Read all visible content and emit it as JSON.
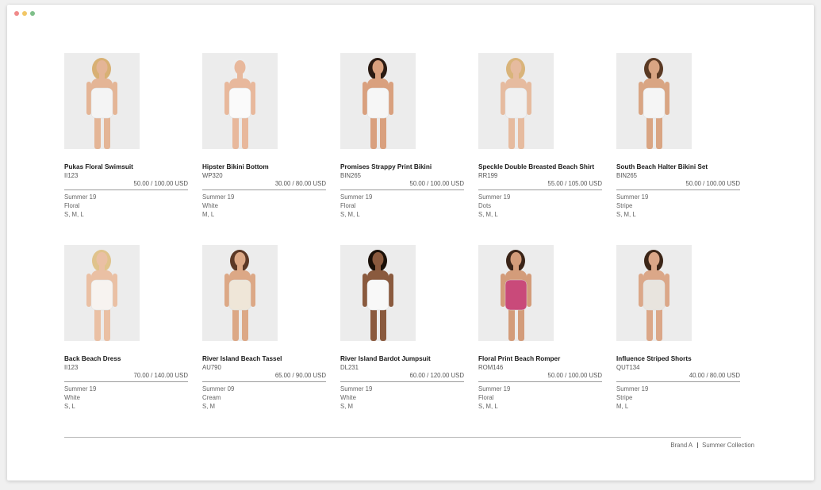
{
  "window": {
    "controls": [
      {
        "name": "close",
        "color": "#f08a8a"
      },
      {
        "name": "minimize",
        "color": "#f2c766"
      },
      {
        "name": "maximize",
        "color": "#7fbf8a"
      }
    ]
  },
  "products": [
    {
      "name": "Pukas Floral Swimsuit",
      "sku": "II123",
      "price": "50.00 / 100.00 USD",
      "season": "Summer 19",
      "pattern": "Floral",
      "sizes": "S, M, L",
      "image": "model-swimsuit-floral",
      "garment_color": "#f4f4f4",
      "skin": "#e4b596",
      "hair": "#d8b074"
    },
    {
      "name": "Hipster Bikini Bottom",
      "sku": "WP320",
      "price": "30.00 / 80.00 USD",
      "season": "Summer 19",
      "pattern": "White",
      "sizes": "M, L",
      "image": "model-bikini-bottom-white",
      "garment_color": "#fafafa",
      "skin": "#e8b89c",
      "hair": "#ededed"
    },
    {
      "name": "Promises Strappy Print Bikini",
      "sku": "BIN265",
      "price": "50.00 / 100.00 USD",
      "season": "Summer 19",
      "pattern": "Floral",
      "sizes": "S, M, L",
      "image": "model-bikini-strappy",
      "garment_color": "#f6f6f6",
      "skin": "#d9a07e",
      "hair": "#2a1a12"
    },
    {
      "name": "Speckle Double Breasted Beach Shirt",
      "sku": "RR199",
      "price": "55.00 / 105.00 USD",
      "season": "Summer 19",
      "pattern": "Dots",
      "sizes": "S, M, L",
      "image": "model-beach-shirt-dots",
      "garment_color": "#f0f0f0",
      "skin": "#e6bb9f",
      "hair": "#d9b47a"
    },
    {
      "name": "South Beach Halter Bikini Set",
      "sku": "BIN265",
      "price": "50.00 / 100.00 USD",
      "season": "Summer 19",
      "pattern": "Stripe",
      "sizes": "S, M, L",
      "image": "model-halter-bikini",
      "garment_color": "#f5f5f5",
      "skin": "#d9a583",
      "hair": "#5a3a24"
    },
    {
      "name": "Back Beach Dress",
      "sku": "II123",
      "price": "70.00 / 140.00 USD",
      "season": "Summer 19",
      "pattern": "White",
      "sizes": "S, L",
      "image": "model-beach-dress-white",
      "garment_color": "#f7f3f0",
      "skin": "#eac0a4",
      "hair": "#e0c38c"
    },
    {
      "name": "River Island Beach Tassel",
      "sku": "AU790",
      "price": "65.00 / 90.00 USD",
      "season": "Summer 09",
      "pattern": "Cream",
      "sizes": "S, M",
      "image": "model-beach-tassel-cream",
      "garment_color": "#efe6d8",
      "skin": "#dca886",
      "hair": "#5b3826"
    },
    {
      "name": "River Island Bardot Jumpsuit",
      "sku": "DL231",
      "price": "60.00 / 120.00 USD",
      "season": "Summer 19",
      "pattern": "White",
      "sizes": "S, M",
      "image": "model-bardot-jumpsuit",
      "garment_color": "#f8f8f8",
      "skin": "#8a5a3e",
      "hair": "#1a1008"
    },
    {
      "name": "Floral Print Beach Romper",
      "sku": "ROM146",
      "price": "50.00 / 100.00 USD",
      "season": "Summer 19",
      "pattern": "Floral",
      "sizes": "S, M, L",
      "image": "model-romper-floral",
      "garment_color": "#c94a7a",
      "skin": "#d39c7a",
      "hair": "#3a2418"
    },
    {
      "name": "Influence Striped Shorts",
      "sku": "QUT134",
      "price": "40.00 / 80.00 USD",
      "season": "Summer 19",
      "pattern": "Stripe",
      "sizes": "M, L",
      "image": "model-striped-shorts",
      "garment_color": "#e8e4de",
      "skin": "#dba788",
      "hair": "#3c2618"
    }
  ],
  "footer": {
    "brand": "Brand A",
    "collection": "Summer Collection"
  }
}
